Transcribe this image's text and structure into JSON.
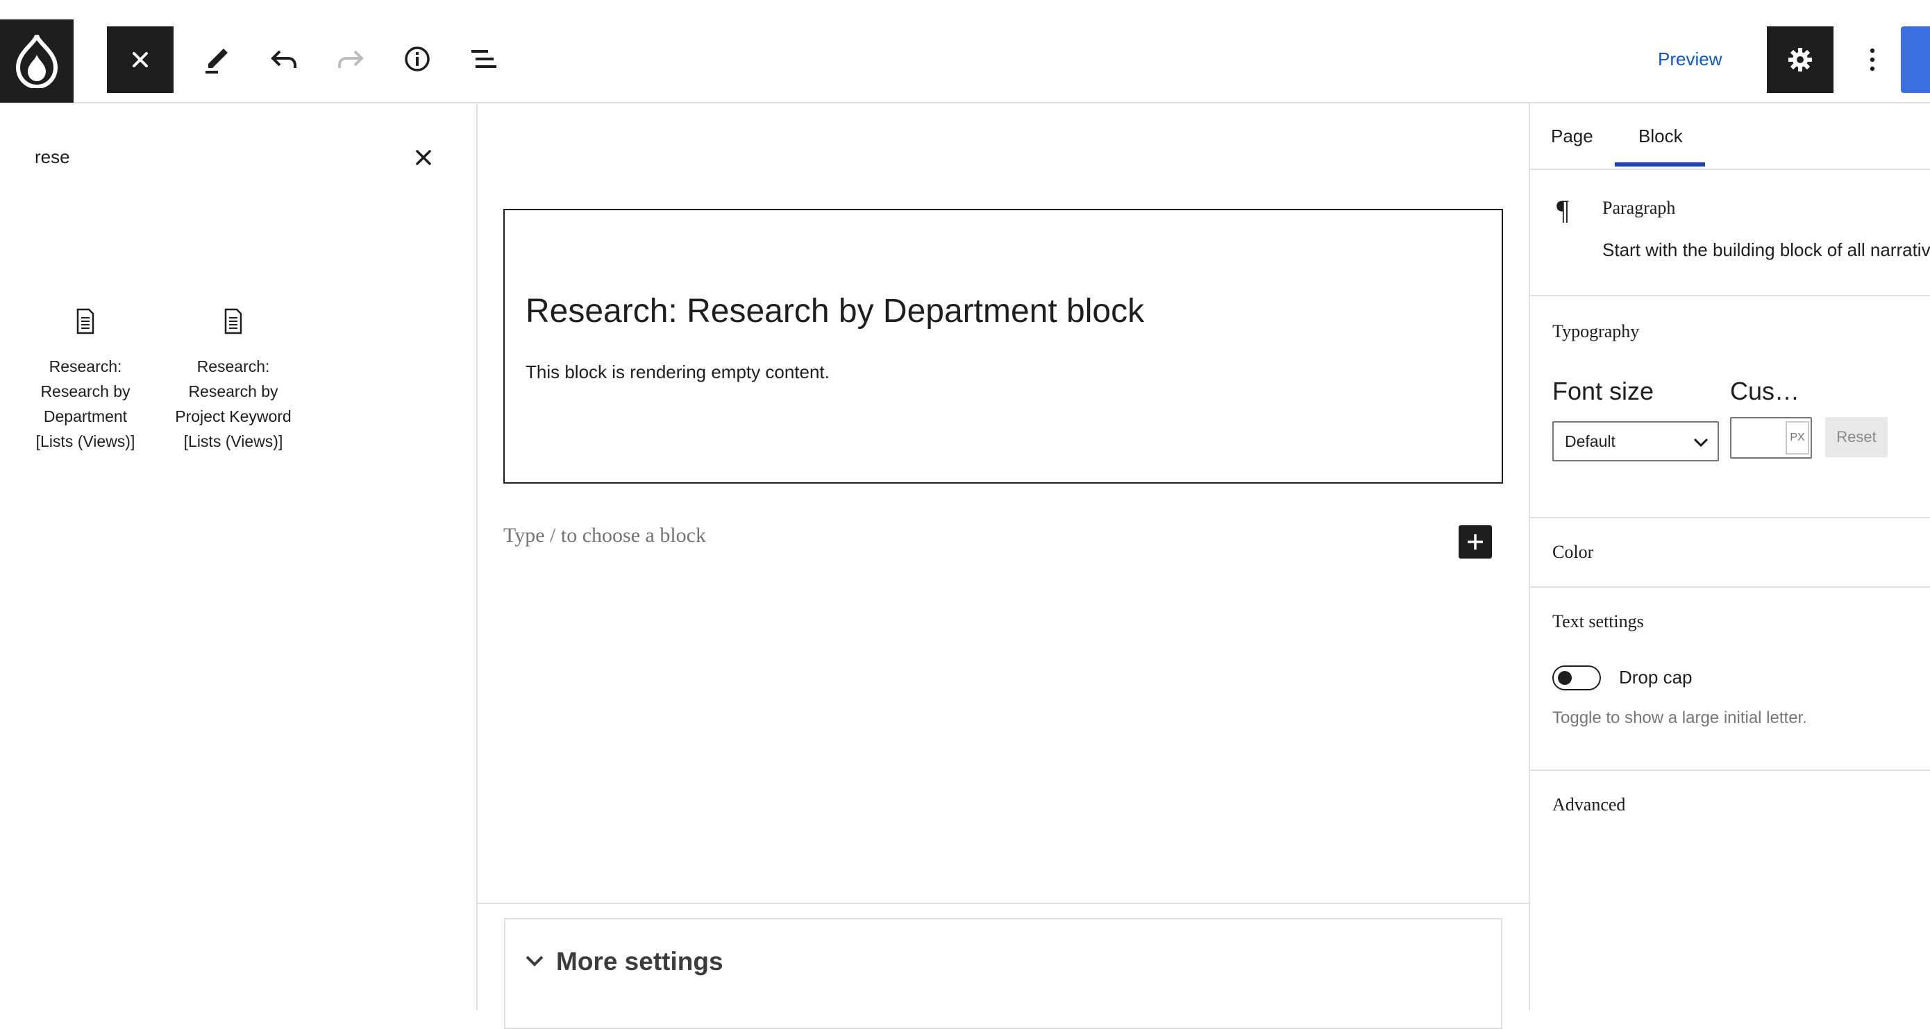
{
  "toolbar": {
    "preview_label": "Preview",
    "accent_color": "#0b57d0",
    "primary_button_color": "#3b6fe0"
  },
  "inserter": {
    "search_value": "rese",
    "results": [
      {
        "label": "Research: Research by Department [Lists (Views)]",
        "icon": "document-icon"
      },
      {
        "label": "Research: Research by Project Keyword [Lists (Views)]",
        "icon": "document-icon"
      }
    ]
  },
  "canvas": {
    "view_block": {
      "title": "Research: Research by Department block",
      "message": "This block is rendering empty content."
    },
    "appender_placeholder": "Type / to choose a block",
    "more_settings_label": "More settings"
  },
  "sidebar": {
    "tabs": [
      {
        "label": "Page"
      },
      {
        "label": "Block"
      }
    ],
    "active_tab": "Block",
    "block_card": {
      "name": "Paragraph",
      "description": "Start with the building block of all narrativ"
    },
    "typography": {
      "title": "Typography",
      "font_size_label": "Font size",
      "custom_label": "Cus…",
      "select_value": "Default",
      "unit": "PX",
      "reset_label": "Reset"
    },
    "color_title": "Color",
    "text_settings": {
      "title": "Text settings",
      "toggle_label": "Drop cap",
      "toggle_help": "Toggle to show a large initial letter.",
      "toggle_on": false
    },
    "advanced_title": "Advanced"
  }
}
